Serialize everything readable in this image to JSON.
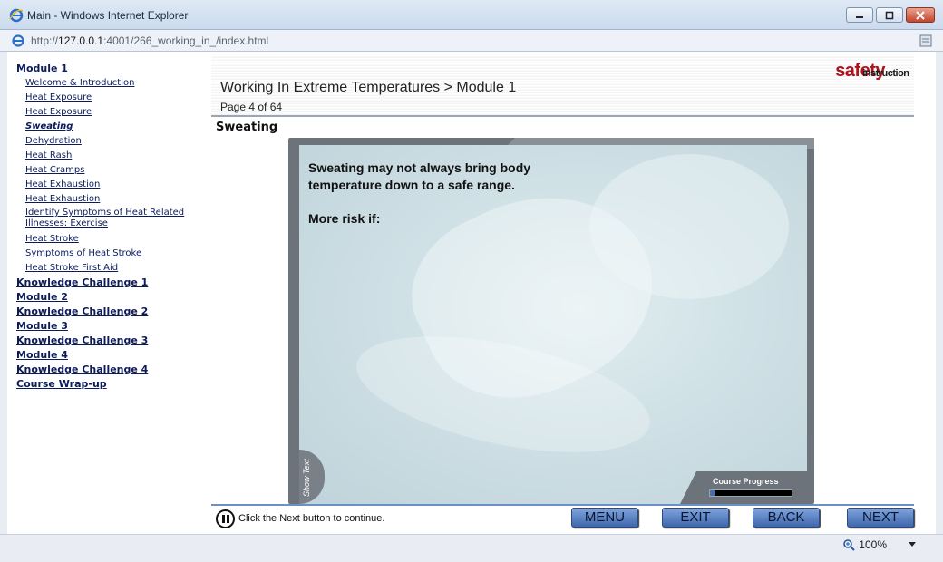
{
  "window": {
    "title": "Main - Windows Internet Explorer",
    "controls": [
      "minimize-icon",
      "restore-icon",
      "close-icon"
    ]
  },
  "address_bar": {
    "url_prefix": "http://",
    "url_host": "127.0.0.1",
    "url_rest": ":4001/266_working_in_/index.html"
  },
  "nav": {
    "items": [
      {
        "label": "Module 1",
        "level": "top"
      },
      {
        "label": "Welcome & Introduction",
        "level": "sub"
      },
      {
        "label": "Heat Exposure",
        "level": "sub"
      },
      {
        "label": "Heat Exposure",
        "level": "sub"
      },
      {
        "label": "Sweating",
        "level": "sub",
        "current": true
      },
      {
        "label": "Dehydration",
        "level": "sub"
      },
      {
        "label": "Heat Rash",
        "level": "sub"
      },
      {
        "label": "Heat Cramps",
        "level": "sub"
      },
      {
        "label": "Heat Exhaustion",
        "level": "sub"
      },
      {
        "label": "Heat Exhaustion",
        "level": "sub"
      },
      {
        "label": "Identify Symptoms of Heat Related Illnesses: Exercise",
        "level": "sub"
      },
      {
        "label": "Heat Stroke",
        "level": "sub"
      },
      {
        "label": "Symptoms of Heat Stroke",
        "level": "sub"
      },
      {
        "label": "Heat Stroke First Aid",
        "level": "sub"
      },
      {
        "label": "Knowledge Challenge 1",
        "level": "top"
      },
      {
        "label": "Module 2",
        "level": "top"
      },
      {
        "label": "Knowledge Challenge 2",
        "level": "top"
      },
      {
        "label": "Module 3",
        "level": "top"
      },
      {
        "label": "Knowledge Challenge 3",
        "level": "top"
      },
      {
        "label": "Module 4",
        "level": "top"
      },
      {
        "label": "Knowledge Challenge 4",
        "level": "top"
      },
      {
        "label": "Course Wrap-up",
        "level": "top"
      }
    ]
  },
  "header": {
    "course_title": "Working In Extreme Temperatures > Module 1",
    "page_count": "Page 4 of 64",
    "logo_part1": "safety",
    "logo_part2": "instruction",
    "logo_colors": {
      "safety": "#b0121b",
      "instruction": "#1a1a1a"
    }
  },
  "section": {
    "title": "Sweating"
  },
  "slide": {
    "text_line1": "Sweating may not always bring body",
    "text_line2": "temperature down to a safe range.",
    "text_line3": "More risk if:",
    "show_text_label": "Show Text",
    "progress_label": "Course Progress",
    "progress_fraction": 0.06
  },
  "controls": {
    "instruction": "Click the Next button to continue.",
    "menu_label": "MENU",
    "exit_label": "EXIT",
    "back_label": "BACK",
    "next_label": "NEXT",
    "button_color": "#5a82c6"
  },
  "status_bar": {
    "zoom": "100%"
  }
}
